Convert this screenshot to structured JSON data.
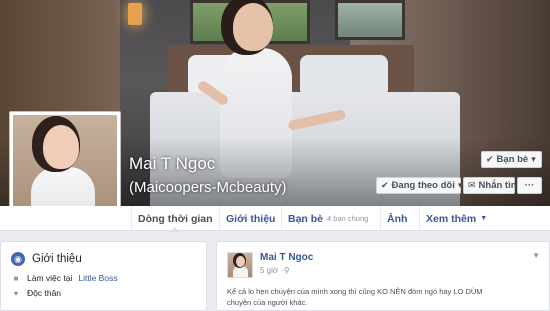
{
  "profile": {
    "name": "Mai T Ngoc",
    "alternate_name": "(Maicoopers-Mcbeauty)"
  },
  "cover_buttons": {
    "friends_label": "Bạn bè",
    "following_label": "Đang theo dõi",
    "message_label": "Nhắn tin",
    "more_label": "···"
  },
  "tabs": {
    "timeline": "Dòng thời gian",
    "about": "Giới thiệu",
    "friends": "Bạn bè",
    "friends_sub": "4 bạn chung",
    "photos": "Ảnh",
    "more": "Xem thêm"
  },
  "intro": {
    "title": "Giới thiệu",
    "work_prefix": "Làm việc tại",
    "work_place": "Little Boss",
    "relationship": "Độc thân"
  },
  "post": {
    "author": "Mai T Ngoc",
    "time": "5 giờ",
    "text": "Kể cả lo hẹn chuyện của mình xong thì cũng KO NÊN đòm ngó hay LO DÙM chuyện của người khác."
  },
  "colors": {
    "link_blue": "#365899",
    "fb_blue": "#4267b2",
    "page_bg": "#e9ebee"
  }
}
